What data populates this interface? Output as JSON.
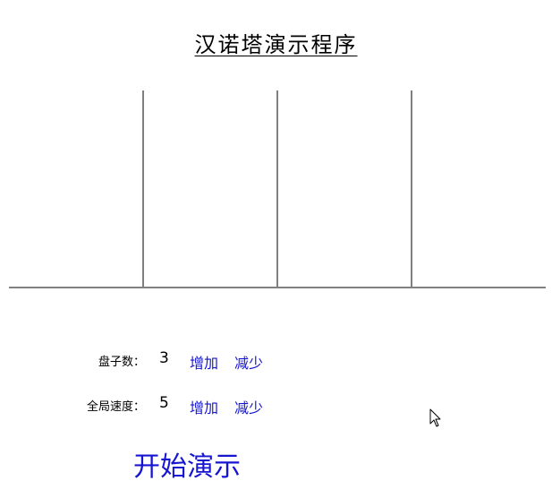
{
  "title": "汉诺塔演示程序",
  "disk_count": {
    "label": "盘子数：",
    "value": "3",
    "increase": "增加",
    "decrease": "减少"
  },
  "global_speed": {
    "label": "全局速度：",
    "value": "5",
    "increase": "增加",
    "decrease": "减少"
  },
  "start_button": "开始演示",
  "colors": {
    "link": "#1515d2",
    "pole": "#808080"
  },
  "icons": [
    "mouse-pointer-icon"
  ]
}
